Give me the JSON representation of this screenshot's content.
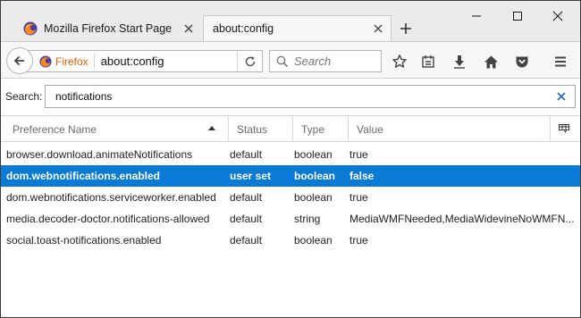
{
  "tabs": [
    {
      "title": "Mozilla Firefox Start Page",
      "active": false,
      "icon": "firefox-icon"
    },
    {
      "title": "about:config",
      "active": true,
      "icon": ""
    }
  ],
  "window_controls": {
    "minimize": "minimize-icon",
    "maximize": "maximize-icon",
    "close": "close-icon"
  },
  "navbar": {
    "identity_label": "Firefox",
    "url": "about:config",
    "search_placeholder": "Search"
  },
  "filter": {
    "label": "Search:",
    "value": "notifications"
  },
  "table": {
    "columns": [
      "Preference Name",
      "Status",
      "Type",
      "Value"
    ],
    "sorted_column": "Preference Name",
    "rows": [
      {
        "name": "browser.download.animateNotifications",
        "status": "default",
        "type": "boolean",
        "value": "true",
        "selected": false
      },
      {
        "name": "dom.webnotifications.enabled",
        "status": "user set",
        "type": "boolean",
        "value": "false",
        "selected": true
      },
      {
        "name": "dom.webnotifications.serviceworker.enabled",
        "status": "default",
        "type": "boolean",
        "value": "true",
        "selected": false
      },
      {
        "name": "media.decoder-doctor.notifications-allowed",
        "status": "default",
        "type": "string",
        "value": "MediaWMFNeeded,MediaWidevineNoWMFN...",
        "selected": false
      },
      {
        "name": "social.toast-notifications.enabled",
        "status": "default",
        "type": "boolean",
        "value": "true",
        "selected": false
      }
    ]
  },
  "colors": {
    "selection": "#0a7ad7",
    "identity": "#e66000"
  }
}
